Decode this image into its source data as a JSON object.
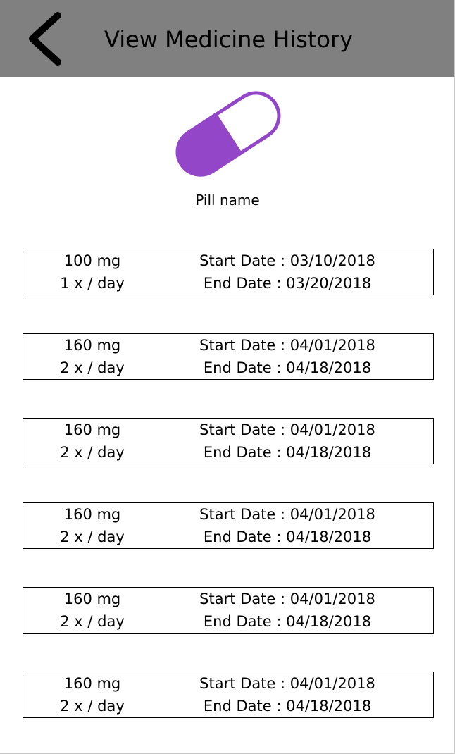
{
  "header": {
    "title": "View Medicine History",
    "back_icon": "chevron-left-icon",
    "background_color": "#808080"
  },
  "pill": {
    "icon": "pill-capsule-icon",
    "color": "#9446c8",
    "name": "Pill name"
  },
  "history": [
    {
      "dose": "100 mg",
      "frequency": "1 x / day",
      "start": "Start Date : 03/10/2018",
      "end": "End Date : 03/20/2018"
    },
    {
      "dose": "160 mg",
      "frequency": "2 x / day",
      "start": "Start Date : 04/01/2018",
      "end": "End Date : 04/18/2018"
    },
    {
      "dose": "160 mg",
      "frequency": "2 x / day",
      "start": "Start Date : 04/01/2018",
      "end": "End Date : 04/18/2018"
    },
    {
      "dose": "160 mg",
      "frequency": "2 x / day",
      "start": "Start Date : 04/01/2018",
      "end": "End Date : 04/18/2018"
    },
    {
      "dose": "160 mg",
      "frequency": "2 x / day",
      "start": "Start Date : 04/01/2018",
      "end": "End Date : 04/18/2018"
    },
    {
      "dose": "160 mg",
      "frequency": "2 x / day",
      "start": "Start Date : 04/01/2018",
      "end": "End Date : 04/18/2018"
    }
  ]
}
